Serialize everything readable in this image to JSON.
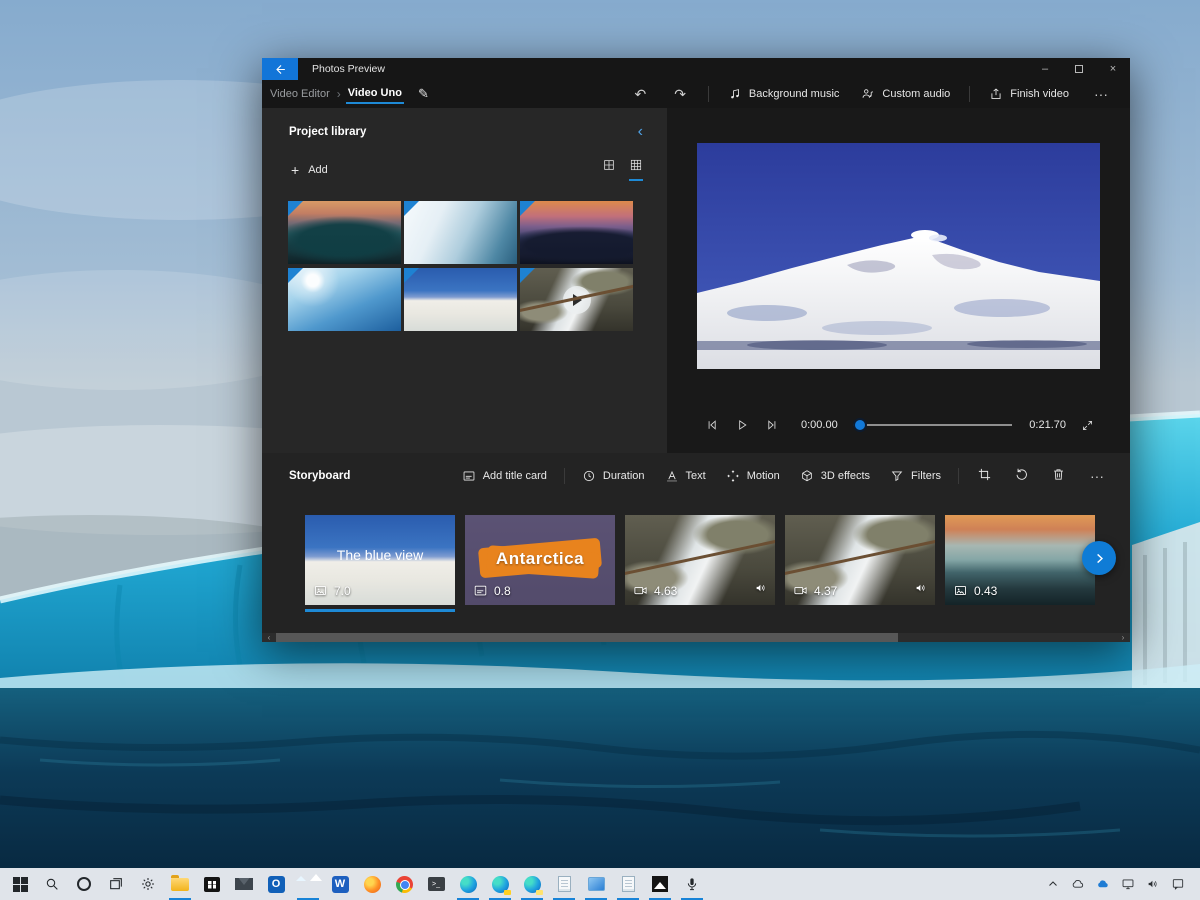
{
  "window": {
    "title": "Photos Preview",
    "breadcrumb": {
      "parent": "Video Editor",
      "separator": "›",
      "current": "Video Uno"
    },
    "commandbar": {
      "background_music_label": "Background music",
      "custom_audio_label": "Custom audio",
      "finish_video_label": "Finish video"
    }
  },
  "icons": {
    "plus": "+",
    "pencil": "✎",
    "undo": "↶",
    "redo": "↷",
    "more": "···",
    "collapse_left": "‹",
    "scroll_left": "‹",
    "scroll_right": "›",
    "minimize": "–",
    "close": "×"
  },
  "library": {
    "title": "Project library",
    "add_label": "Add",
    "items": [
      {
        "art": "iceberg-sunset-teal",
        "selected": true
      },
      {
        "art": "iceberg-wall-closeup",
        "selected": true
      },
      {
        "art": "iceberg-sunset-purple",
        "selected": true
      },
      {
        "art": "blue-iceberg-sunflare",
        "selected": true
      },
      {
        "art": "snowy-mountain",
        "selected": true
      },
      {
        "art": "rocky-waterfall-video",
        "selected": true,
        "is_video": true
      }
    ]
  },
  "player": {
    "current_time": "0:00.00",
    "total_time": "0:21.70",
    "progress_percent": 0
  },
  "storyboard": {
    "title": "Storyboard",
    "add_title_card_label": "Add title card",
    "tools": [
      {
        "label": "Duration"
      },
      {
        "label": "Text"
      },
      {
        "label": "Motion"
      },
      {
        "label": "3D effects"
      },
      {
        "label": "Filters"
      }
    ],
    "clips": [
      {
        "title": "The blue view",
        "duration": "7.0",
        "type": "image",
        "selected": true
      },
      {
        "title": "Antarctica",
        "duration": "0.8",
        "type": "title-card"
      },
      {
        "duration": "4.63",
        "type": "video",
        "has_audio": true
      },
      {
        "duration": "4.37",
        "type": "video",
        "has_audio": true
      },
      {
        "duration": "0.43",
        "type": "image"
      }
    ]
  },
  "colors": {
    "accent_blue": "#0f7cd6",
    "selection_underline": "#1e8ad6",
    "window_bg": "#1b1b1b",
    "library_bg": "#272727",
    "storyboard_bg": "#232323",
    "taskbar_bg": "#e9ecf1"
  },
  "taskbar": {
    "icons": [
      "start",
      "search",
      "cortana",
      "task-view",
      "settings",
      "file-explorer",
      "store",
      "mail",
      "outlook",
      "photos",
      "word",
      "firefox",
      "chrome",
      "terminal",
      "edge",
      "edge-beta",
      "edge-canary",
      "notepad",
      "movies-tv",
      "notepad-2",
      "photos-legacy",
      "voice-recorder"
    ],
    "tray": [
      "tray-expand",
      "onedrive",
      "onedrive-blue",
      "display",
      "volume",
      "action-center"
    ]
  }
}
